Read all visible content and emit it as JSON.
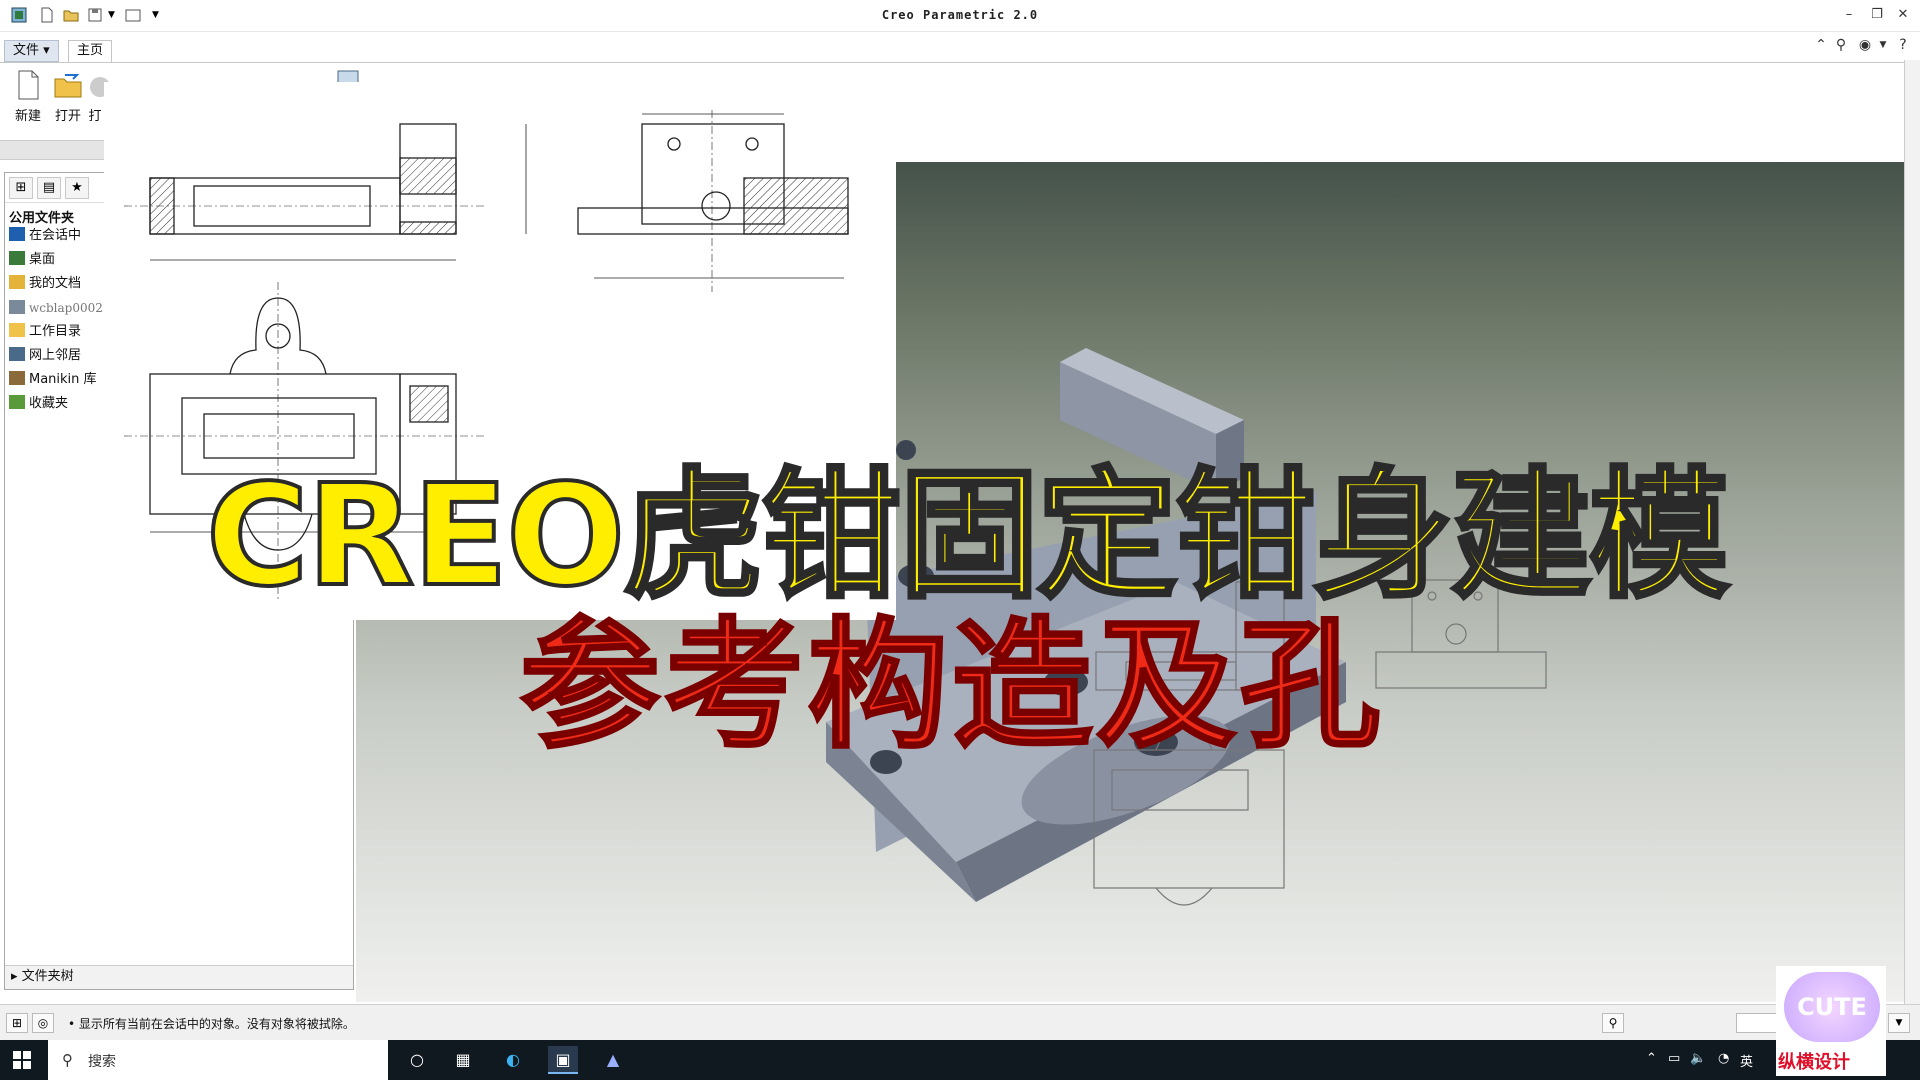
{
  "window": {
    "title": "Creo Parametric 2.0"
  },
  "menu": {
    "file_tab": "文件 ▾",
    "home_tab": "主页"
  },
  "ribbon": {
    "new_label": "新建",
    "open_label": "打开",
    "open_other_label": "打"
  },
  "navigator": {
    "header": "公用文件夹",
    "items": [
      {
        "label": "在会话中",
        "icon": "session-icon"
      },
      {
        "label": "桌面",
        "icon": "desktop-icon"
      },
      {
        "label": "我的文档",
        "icon": "documents-icon"
      },
      {
        "label": "wcblap0002",
        "icon": "computer-icon"
      },
      {
        "label": "工作目录",
        "icon": "folder-icon"
      },
      {
        "label": "网上邻居",
        "icon": "network-icon"
      },
      {
        "label": "Manikin 库",
        "icon": "library-icon"
      },
      {
        "label": "收藏夹",
        "icon": "favorites-icon"
      }
    ],
    "footer": "文件夹树"
  },
  "status": {
    "message": "• 显示所有当前在会话中的对象。没有对象将被拭除。"
  },
  "overlay": {
    "headline": "CREO虎钳固定钳身建模",
    "subheadline": "参考构造及孔"
  },
  "taskbar": {
    "search_placeholder": "搜索",
    "ime": "英"
  },
  "watermark": {
    "badge": "CUTE",
    "text": "纵横设计"
  },
  "colors": {
    "headline": "#ffee00",
    "subheadline": "#ef2a16",
    "accent": "#1f6fd1"
  }
}
